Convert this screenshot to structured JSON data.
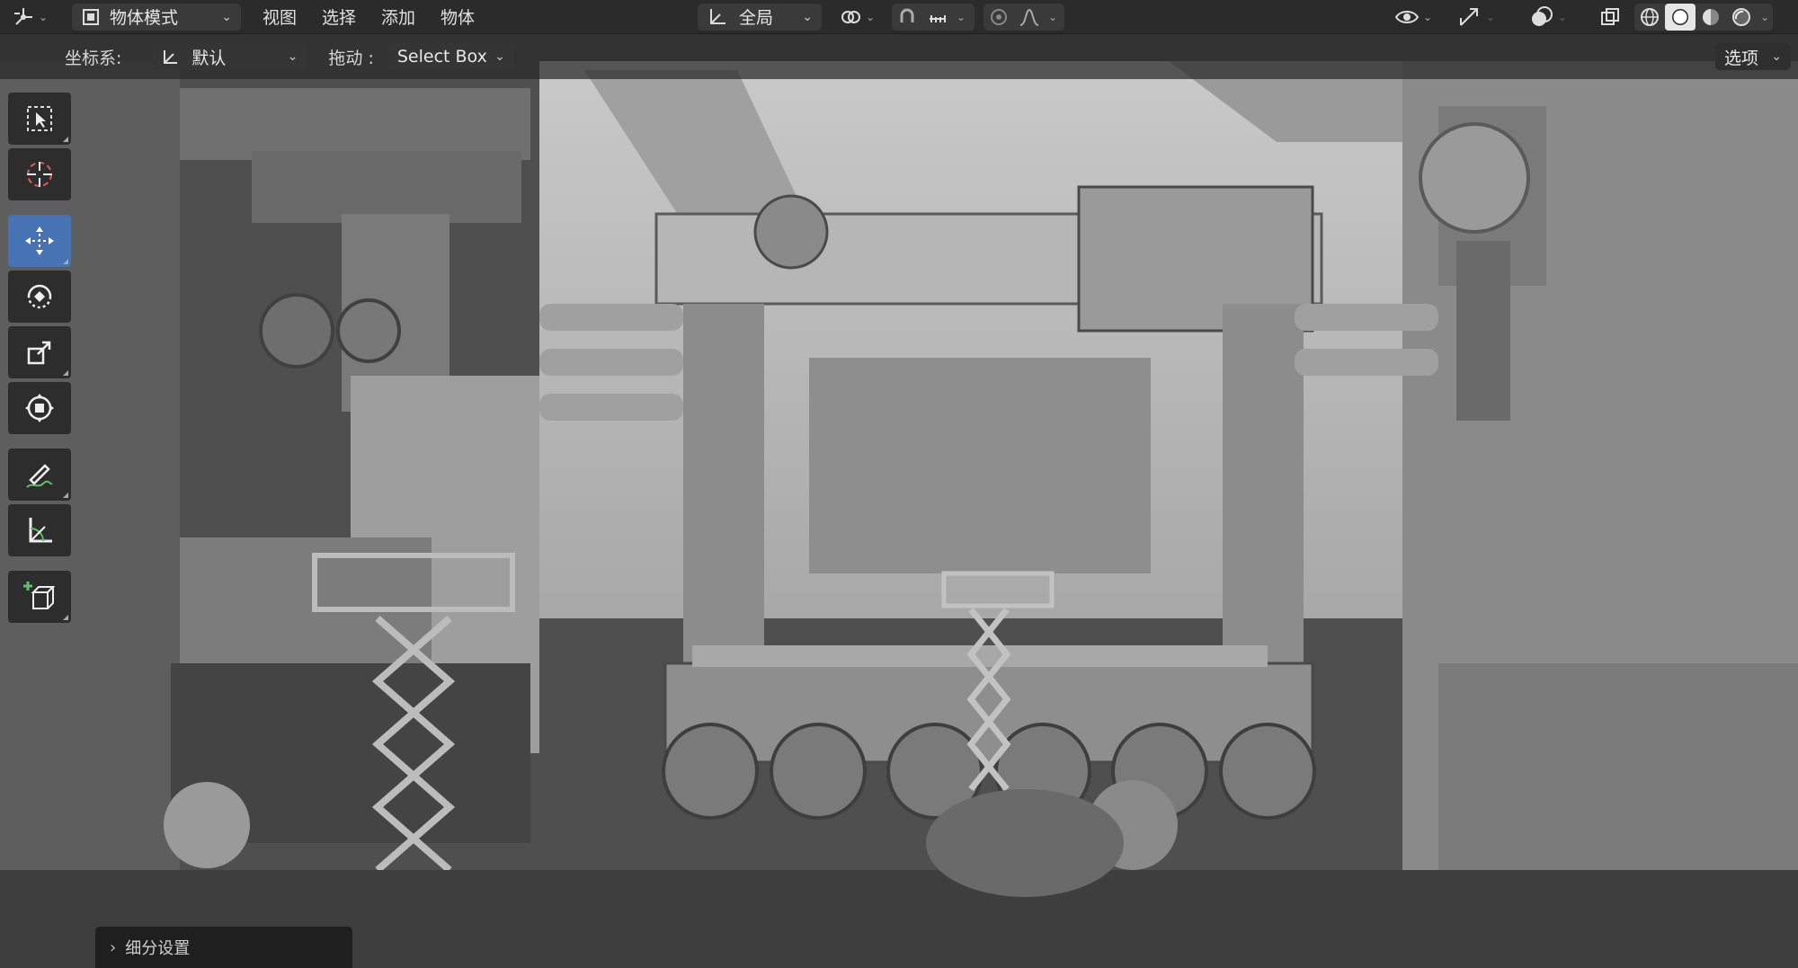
{
  "header": {
    "editor_type_icon": "axis-gizmo-icon",
    "mode_label": "物体模式",
    "menus": [
      "视图",
      "选择",
      "添加",
      "物体"
    ],
    "transform_orientation": "全局",
    "options_label": "选项"
  },
  "tool_header": {
    "coord_label": "坐标系:",
    "coord_value": "默认",
    "drag_label": "拖动 :",
    "drag_value": "Select Box"
  },
  "toolbar": {
    "tools": [
      {
        "name": "select-box",
        "icon": "select-box-icon",
        "active": false
      },
      {
        "name": "cursor",
        "icon": "cursor-icon",
        "active": false
      },
      {
        "name": "move",
        "icon": "move-icon",
        "active": true
      },
      {
        "name": "rotate",
        "icon": "rotate-icon",
        "active": false
      },
      {
        "name": "scale",
        "icon": "scale-icon",
        "active": false
      },
      {
        "name": "transform",
        "icon": "transform-icon",
        "active": false
      },
      {
        "name": "annotate",
        "icon": "annotate-icon",
        "active": false
      },
      {
        "name": "measure",
        "icon": "measure-icon",
        "active": false
      },
      {
        "name": "add-cube",
        "icon": "add-cube-icon",
        "active": false
      }
    ]
  },
  "last_operator_panel": {
    "label": "细分设置"
  },
  "colors": {
    "active_tool": "#4772b3",
    "header_bg": "#2b2b2b",
    "button_bg": "#3a3a3a"
  }
}
